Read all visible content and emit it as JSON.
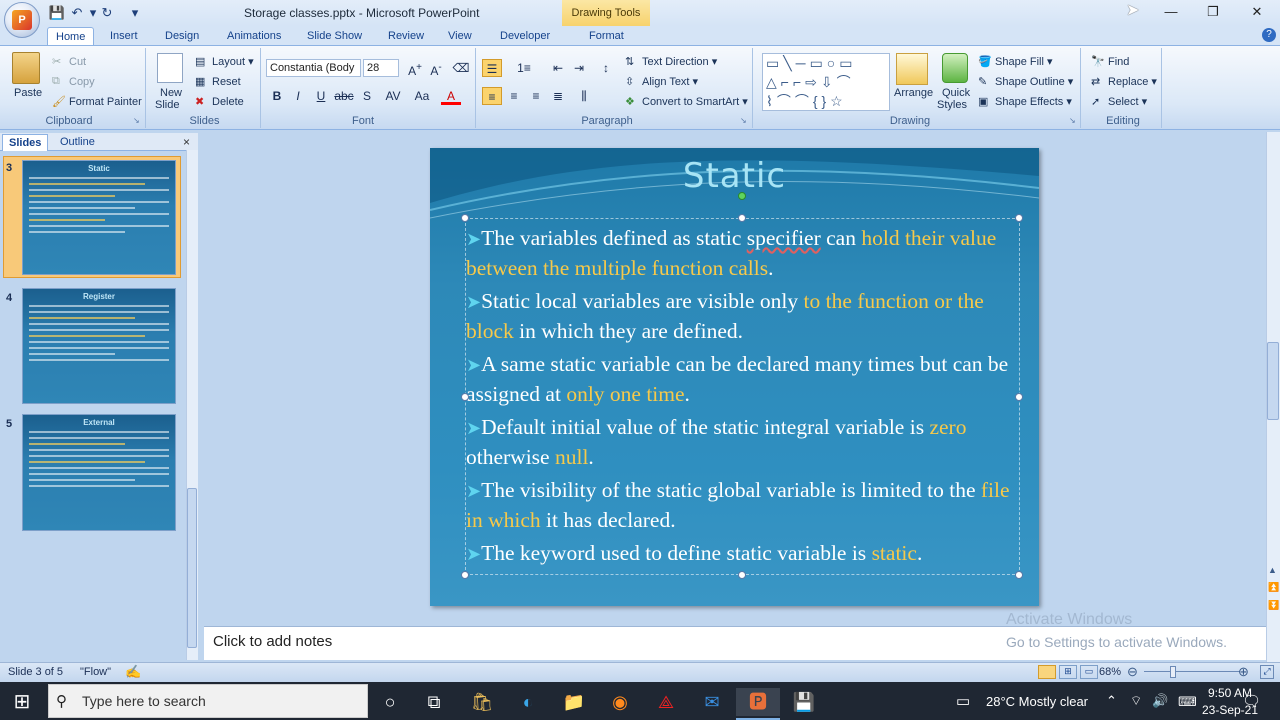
{
  "window": {
    "doc_title": "Storage classes.pptx - Microsoft PowerPoint",
    "contextual_tab": "Drawing Tools",
    "minimize": "—",
    "maximize": "❐",
    "close": "✕"
  },
  "tabs": [
    "Home",
    "Insert",
    "Design",
    "Animations",
    "Slide Show",
    "Review",
    "View",
    "Developer",
    "Format"
  ],
  "ribbon": {
    "clipboard": {
      "label": "Clipboard",
      "paste": "Paste",
      "cut": "Cut",
      "copy": "Copy",
      "format_painter": "Format Painter"
    },
    "slides": {
      "label": "Slides",
      "new_slide_1": "New",
      "new_slide_2": "Slide",
      "layout": "Layout",
      "reset": "Reset",
      "delete": "Delete"
    },
    "font": {
      "label": "Font",
      "family": "Constantia (Body",
      "size": "28"
    },
    "paragraph": {
      "label": "Paragraph",
      "text_direction": "Text Direction",
      "align_text": "Align Text",
      "convert_smartart": "Convert to SmartArt"
    },
    "drawing": {
      "label": "Drawing",
      "arrange": "Arrange",
      "quick_styles_1": "Quick",
      "quick_styles_2": "Styles",
      "shape_fill": "Shape Fill",
      "shape_outline": "Shape Outline",
      "shape_effects": "Shape Effects"
    },
    "editing": {
      "label": "Editing",
      "find": "Find",
      "replace": "Replace",
      "select": "Select"
    }
  },
  "left_pane": {
    "tab_slides": "Slides",
    "tab_outline": "Outline",
    "thumbnails": [
      {
        "num": "3",
        "title": "Static"
      },
      {
        "num": "4",
        "title": "Register"
      },
      {
        "num": "5",
        "title": "External"
      }
    ]
  },
  "slide": {
    "title": "Static",
    "bullets": [
      {
        "segments": [
          {
            "t": "The variables defined as static "
          },
          {
            "t": "specifier",
            "s": "sq"
          },
          {
            "t": " can "
          },
          {
            "t": "hold their value between the multiple function calls",
            "s": "hl"
          },
          {
            "t": "."
          }
        ]
      },
      {
        "segments": [
          {
            "t": "Static local variables are visible only "
          },
          {
            "t": "to the function or the block",
            "s": "hl"
          },
          {
            "t": " in which they are defined."
          }
        ]
      },
      {
        "segments": [
          {
            "t": "A same static variable can be declared many times but can be assigned at "
          },
          {
            "t": "only one time",
            "s": "hl"
          },
          {
            "t": "."
          }
        ]
      },
      {
        "segments": [
          {
            "t": "Default initial value of the static integral variable is "
          },
          {
            "t": "zero",
            "s": "hl"
          },
          {
            "t": " otherwise "
          },
          {
            "t": "null",
            "s": "hl"
          },
          {
            "t": "."
          }
        ]
      },
      {
        "segments": [
          {
            "t": "The visibility of the static global variable is limited to the "
          },
          {
            "t": "file in which",
            "s": "hl"
          },
          {
            "t": " it has declared."
          }
        ]
      },
      {
        "segments": [
          {
            "t": "The keyword used to define static variable is "
          },
          {
            "t": "static",
            "s": "hl"
          },
          {
            "t": "."
          }
        ]
      }
    ]
  },
  "notes_placeholder": "Click to add notes",
  "watermark": {
    "line1": "Activate Windows",
    "line2": "Go to Settings to activate Windows."
  },
  "status": {
    "slide_info": "Slide 3 of 5",
    "theme": "\"Flow\"",
    "zoom": "68%"
  },
  "taskbar": {
    "search_placeholder": "Type here to search",
    "weather": "28°C  Mostly clear",
    "time": "9:50 AM",
    "date": "23-Sep-21"
  }
}
